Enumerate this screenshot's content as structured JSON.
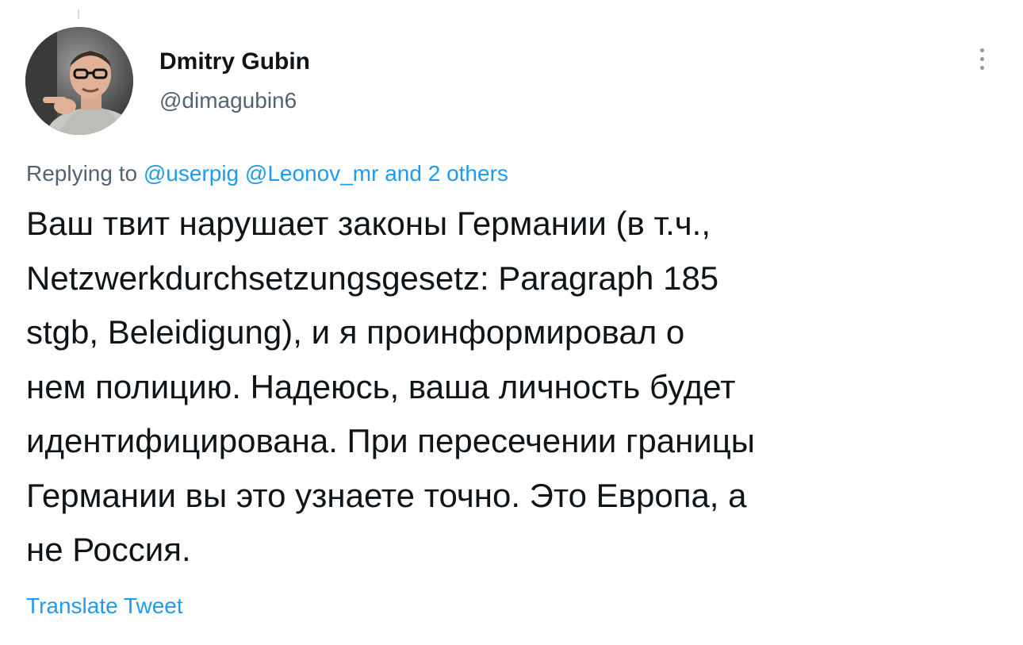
{
  "tweet": {
    "author": {
      "display_name": "Dmitry Gubin",
      "handle": "@dimagubin6"
    },
    "reply_context": {
      "prefix": "Replying to",
      "mentions": [
        "@userpig",
        "@Leonov_mr"
      ],
      "conjunction": "and",
      "others": "2 others"
    },
    "text_lines": [
      "Ваш твит нарушает законы Германии (в т.ч.,",
      "Netzwerkdurchsetzungsgesetz: Paragraph 185",
      "stgb, Beleidigung), и я проинформировал о",
      "нем полицию. Надеюсь, ваша личность будет",
      "идентифицирована. При пересечении границы",
      "Германии вы это узнаете точно. Это Европа, а",
      "не Россия."
    ],
    "translate_label": "Translate Tweet",
    "more_icon": "more-dots-icon"
  },
  "colors": {
    "text_primary": "#0f1419",
    "text_secondary": "#536471",
    "link": "#1d9bf0"
  }
}
